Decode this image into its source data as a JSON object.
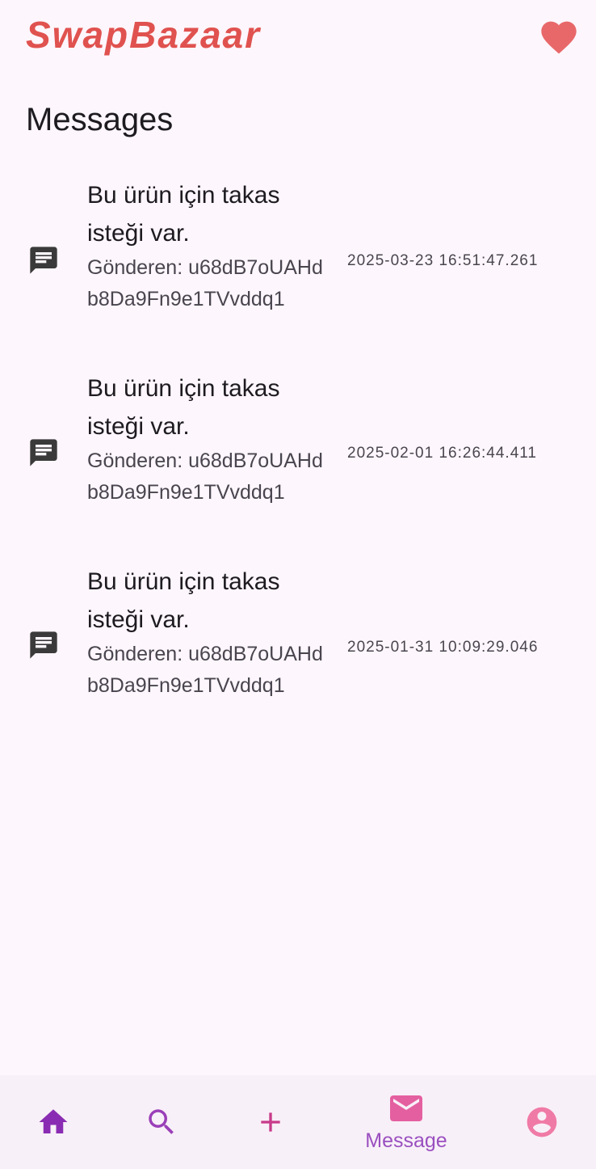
{
  "app": {
    "title": "SwapBazaar"
  },
  "page": {
    "title": "Messages"
  },
  "messages": [
    {
      "title": "Bu ürün için takas isteği var.",
      "sender": "Gönderen: u68dB7oUAHdb8Da9Fn9e1TVvddq1",
      "timestamp": "2025-03-23 16:51:47.261"
    },
    {
      "title": "Bu ürün için takas isteği var.",
      "sender": "Gönderen: u68dB7oUAHdb8Da9Fn9e1TVvddq1",
      "timestamp": "2025-02-01 16:26:44.411"
    },
    {
      "title": "Bu ürün için takas isteği var.",
      "sender": "Gönderen: u68dB7oUAHdb8Da9Fn9e1TVvddq1",
      "timestamp": "2025-01-31 10:09:29.046"
    }
  ],
  "nav": {
    "items": [
      {
        "icon": "home-icon",
        "label": ""
      },
      {
        "icon": "search-icon",
        "label": ""
      },
      {
        "icon": "plus-icon",
        "label": ""
      },
      {
        "icon": "mail-icon",
        "label": "Message",
        "active": true
      },
      {
        "icon": "account-icon",
        "label": ""
      }
    ]
  },
  "colors": {
    "brand": "#e0524f",
    "heart": "#e8686a",
    "nav_purple": "#8a2cb3",
    "nav_pink": "#e45fa0",
    "background": "#fdf6fc"
  }
}
